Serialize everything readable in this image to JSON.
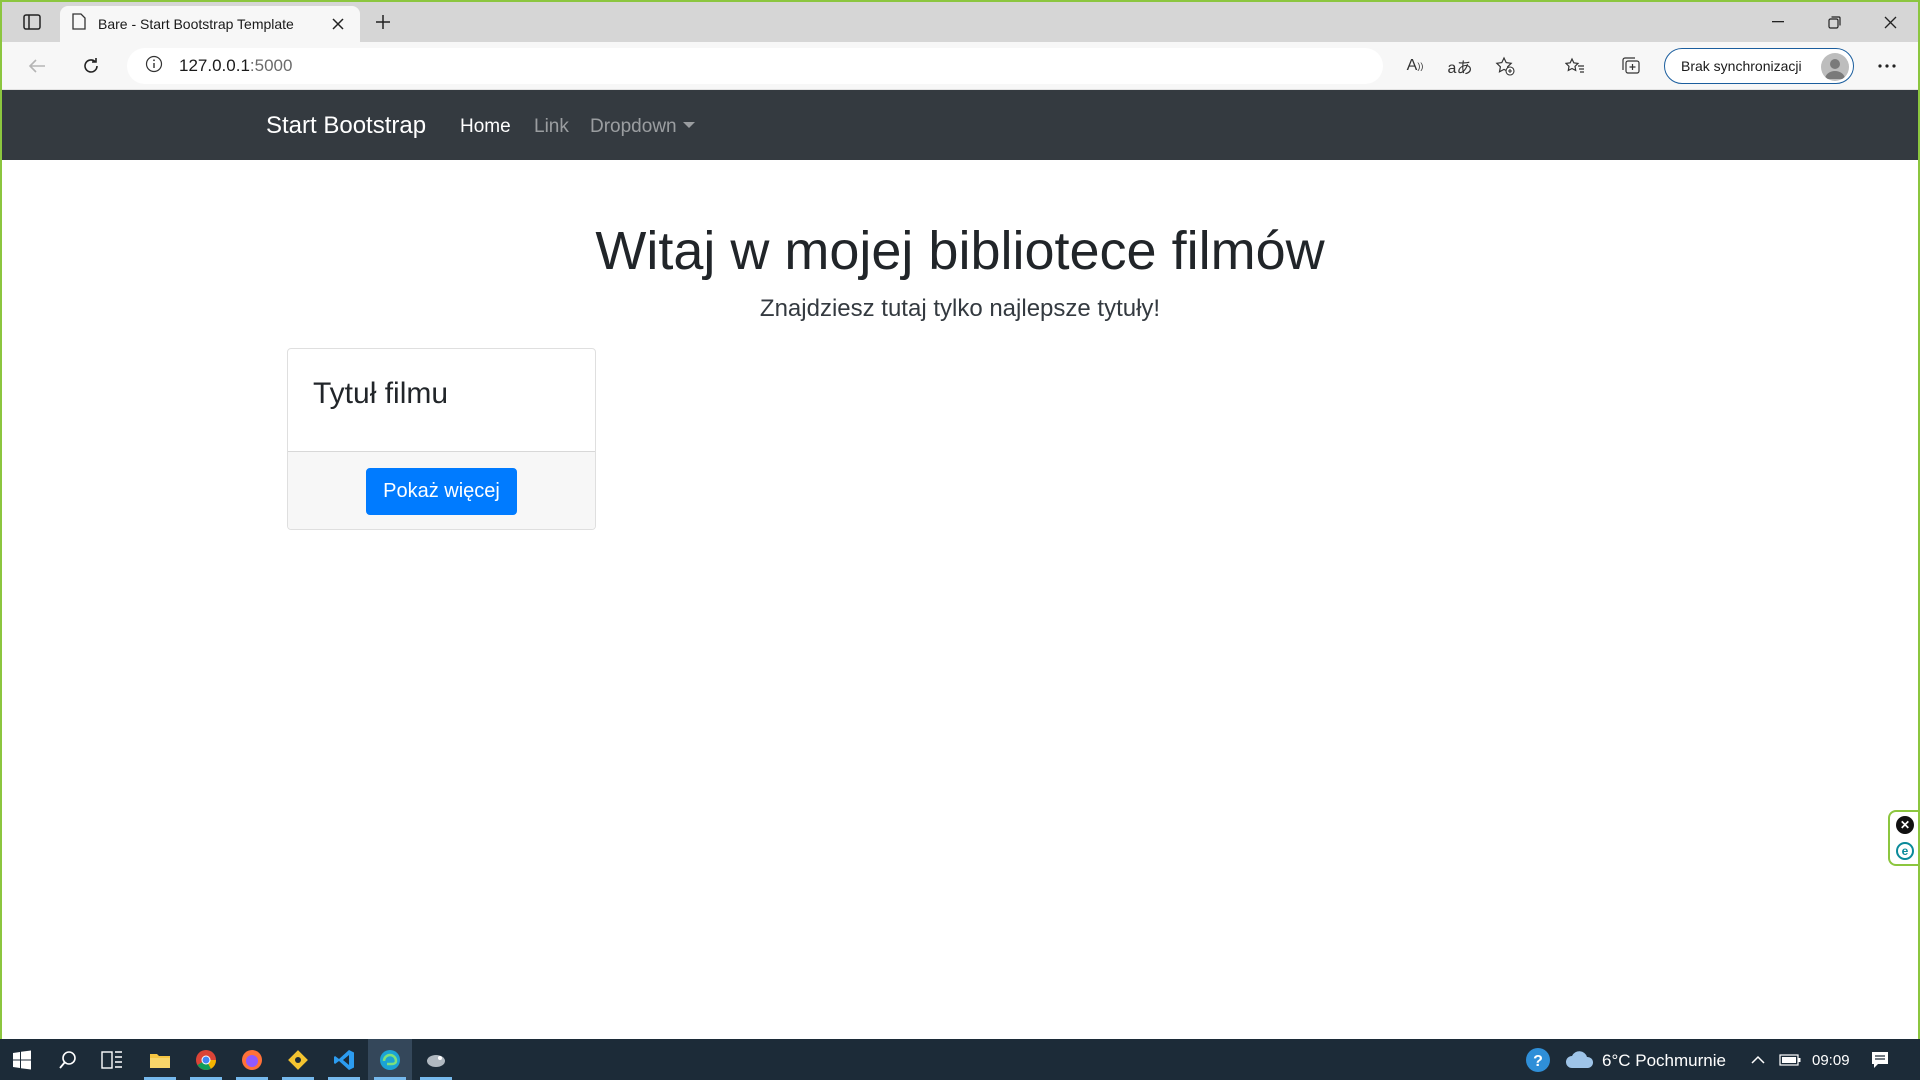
{
  "browser": {
    "tab_title": "Bare - Start Bootstrap Template",
    "url_host": "127.0.0.1",
    "url_port": ":5000",
    "sync_label": "Brak synchronizacji",
    "accent_color": "#8cc63f"
  },
  "navbar": {
    "brand": "Start Bootstrap",
    "home": "Home",
    "link": "Link",
    "dropdown": "Dropdown",
    "background": "#343a40"
  },
  "hero": {
    "title": "Witaj w mojej bibliotece filmów",
    "lead": "Znajdziesz tutaj tylko najlepsze tytuły!"
  },
  "card": {
    "title": "Tytuł filmu",
    "button": "Pokaż więcej",
    "button_color": "#007bff"
  },
  "taskbar": {
    "weather": "6°C  Pochmurnie",
    "clock": "09:09",
    "apps": [
      "windows-start-icon",
      "search-icon",
      "task-view-icon",
      "file-explorer-icon",
      "chrome-icon",
      "firefox-icon",
      "git-icon",
      "vscode-icon",
      "edge-icon",
      "app-icon"
    ]
  }
}
